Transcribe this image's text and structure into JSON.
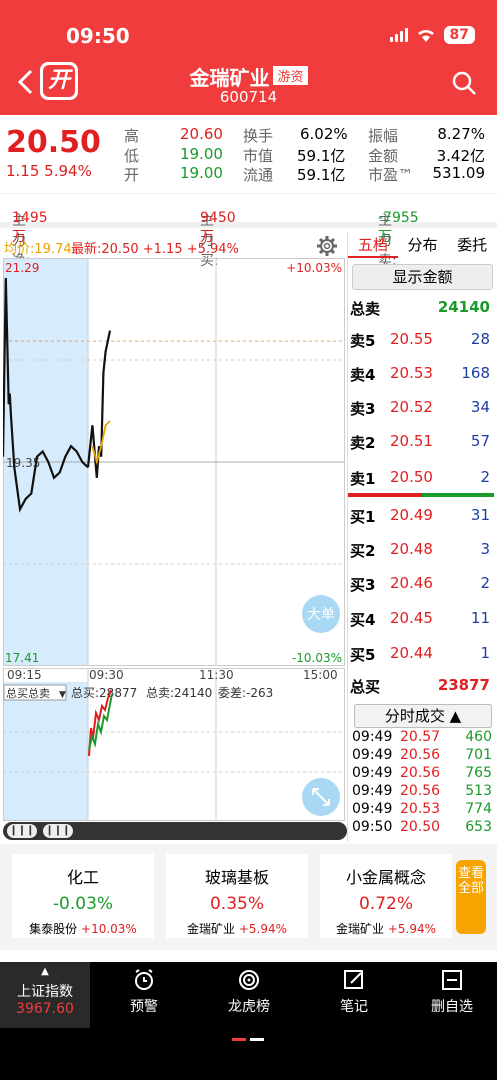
{
  "status": {
    "time": "09:50",
    "battery": "87"
  },
  "header": {
    "open_label": "开",
    "title": "金瑞矿业",
    "badge": "游资",
    "code": "600714"
  },
  "quote": {
    "price": "20.50",
    "change": "1.15 5.94%",
    "rows": [
      {
        "l1": "高",
        "v1": "20.60",
        "l2": "换手",
        "v2": "6.02%",
        "l3": "振幅",
        "v3": "8.27%"
      },
      {
        "l1": "低",
        "v1": "19.00",
        "l2": "市值",
        "v2": "59.1亿",
        "l3": "金额",
        "v3": "3.42亿"
      },
      {
        "l1": "开",
        "v1": "19.00",
        "l2": "流通",
        "v2": "59.1亿",
        "l3": "市盈™",
        "v3": "531.09"
      }
    ]
  },
  "flow": {
    "net_label": "主力净:",
    "net_value": "1495万",
    "buy_label": "主力买:",
    "buy_value": "9450万",
    "sell_label": "主力卖:",
    "sell_value": "-7955万"
  },
  "chart_head": {
    "avg_label": "均价:",
    "avg_value": "19.74",
    "last_label": "最新:",
    "last_value": "20.50",
    "change": "+1.15 +5.94%"
  },
  "chart_data": {
    "type": "line",
    "y_top_label": "21.29",
    "y_mid_label": "19.35",
    "y_bottom_label": "17.41",
    "pct_top_label": "+10.03%",
    "pct_bottom_label": "-10.03%",
    "ylim": [
      17.41,
      21.29
    ],
    "x_ticks": [
      "09:15",
      "09:30",
      "11:30",
      "15:00"
    ],
    "auction_series": {
      "name": "",
      "x_min": [
        0,
        0.5,
        1,
        1.2,
        1.4,
        2,
        3,
        4,
        5,
        6,
        7,
        8,
        9,
        10,
        11,
        12,
        13,
        14,
        15
      ],
      "values": [
        19.4,
        21.1,
        19.9,
        20.0,
        19.8,
        19.3,
        18.9,
        19.0,
        19.05,
        19.4,
        19.45,
        19.35,
        19.2,
        19.25,
        19.4,
        19.5,
        19.45,
        19.35,
        19.3
      ]
    },
    "price_series": {
      "name": "",
      "x_min": [
        15,
        16,
        17,
        17.5,
        18,
        18.5,
        19,
        19.5,
        20
      ],
      "values": [
        19.3,
        19.7,
        19.2,
        19.5,
        19.4,
        20.2,
        20.4,
        20.5,
        20.6
      ]
    },
    "avg_series": {
      "name": "",
      "x_min": [
        16,
        17,
        18,
        19,
        20
      ],
      "values": [
        19.5,
        19.35,
        19.5,
        19.7,
        19.74
      ]
    },
    "vol_label": "总买总卖",
    "vol_stats": {
      "buy": "总买:28877",
      "sell": "总卖:24140",
      "diff": "委差:-263"
    },
    "big_order_label": "大单"
  },
  "orderbook": {
    "tabs": [
      "五档",
      "分布",
      "委托"
    ],
    "show_amount": "显示金额",
    "total_sell_label": "总卖",
    "total_sell": "24140",
    "asks": [
      {
        "label": "卖5",
        "price": "20.55",
        "vol": "28"
      },
      {
        "label": "卖4",
        "price": "20.53",
        "vol": "168"
      },
      {
        "label": "卖3",
        "price": "20.52",
        "vol": "34"
      },
      {
        "label": "卖2",
        "price": "20.51",
        "vol": "57"
      },
      {
        "label": "卖1",
        "price": "20.50",
        "vol": "2"
      }
    ],
    "bids": [
      {
        "label": "买1",
        "price": "20.49",
        "vol": "31"
      },
      {
        "label": "买2",
        "price": "20.48",
        "vol": "3"
      },
      {
        "label": "买3",
        "price": "20.46",
        "vol": "2"
      },
      {
        "label": "买4",
        "price": "20.45",
        "vol": "11"
      },
      {
        "label": "买5",
        "price": "20.44",
        "vol": "1"
      }
    ],
    "total_buy_label": "总买",
    "total_buy": "23877",
    "ticks_label": "分时成交",
    "ticks": [
      {
        "t": "09:49",
        "p": "20.57",
        "v": "460"
      },
      {
        "t": "09:49",
        "p": "20.56",
        "v": "701"
      },
      {
        "t": "09:49",
        "p": "20.56",
        "v": "765"
      },
      {
        "t": "09:49",
        "p": "20.56",
        "v": "513"
      },
      {
        "t": "09:49",
        "p": "20.53",
        "v": "774"
      },
      {
        "t": "09:50",
        "p": "20.50",
        "v": "653"
      }
    ]
  },
  "sectors": [
    {
      "name": "化工",
      "change": "-0.03%",
      "stock": "集泰股份",
      "stock_change": "+10.03%"
    },
    {
      "name": "玻璃基板",
      "change": "0.35%",
      "stock": "金瑞矿业",
      "stock_change": "+5.94%"
    },
    {
      "name": "小金属概念",
      "change": "0.72%",
      "stock": "金瑞矿业",
      "stock_change": "+5.94%"
    }
  ],
  "view_all": "查看全部",
  "bottom": {
    "index_name": "上证指数",
    "index_value": "3967.60",
    "items": [
      "预警",
      "龙虎榜",
      "笔记",
      "删自选"
    ]
  },
  "colors": {
    "brand": "#f03c3c",
    "up": "#e02020",
    "down": "#1a9a2a"
  }
}
